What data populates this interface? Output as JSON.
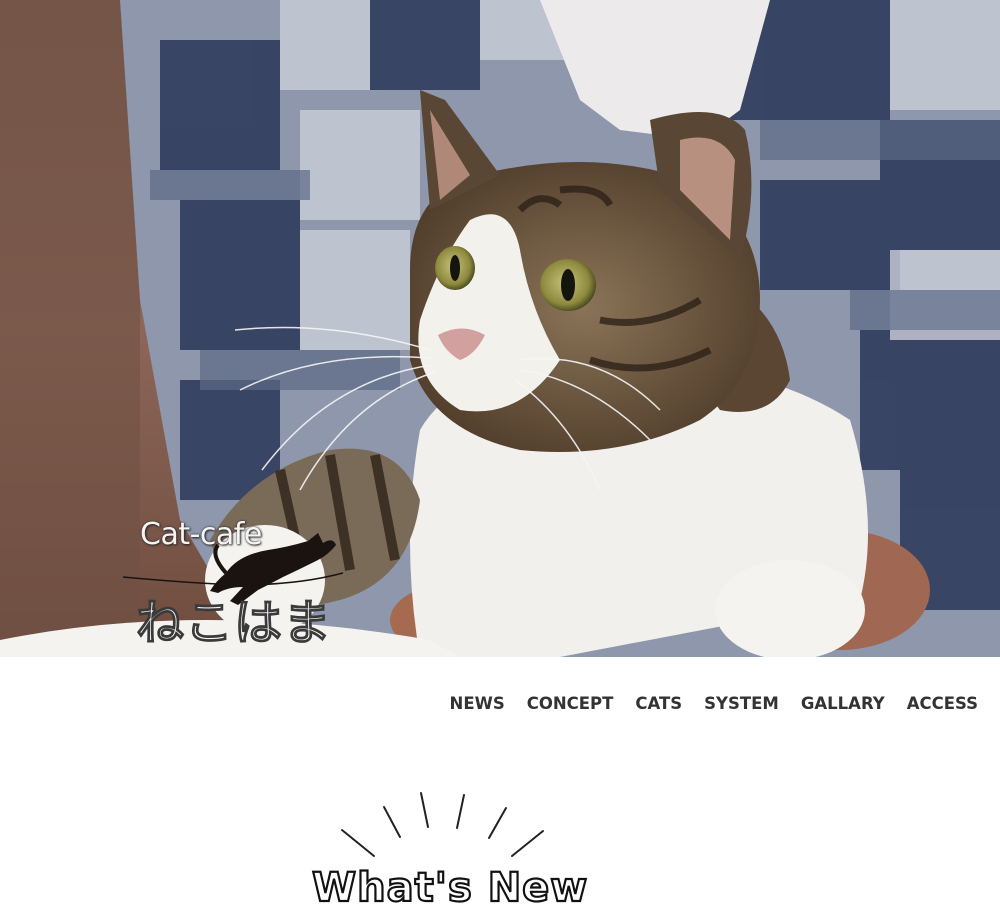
{
  "hero": {
    "logo_en": "Cat-cafe",
    "logo_ja": "ねこはま"
  },
  "nav": {
    "items": [
      {
        "label": "NEWS"
      },
      {
        "label": "CONCEPT"
      },
      {
        "label": "CATS"
      },
      {
        "label": "SYSTEM"
      },
      {
        "label": "GALLARY"
      },
      {
        "label": "ACCESS"
      }
    ]
  },
  "news": {
    "title": "What's New"
  }
}
